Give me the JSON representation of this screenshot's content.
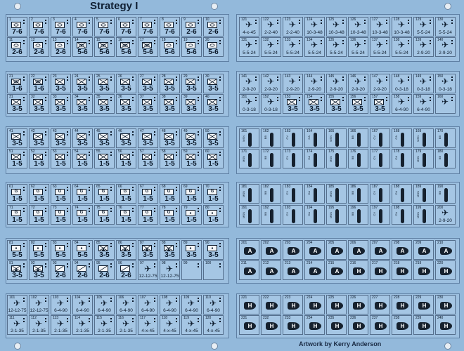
{
  "sheet": {
    "title": "Strategy I",
    "credit": "Artwork by Kerry Anderson",
    "colors": {
      "background": "#93b9db",
      "counter": "#a5c6e4",
      "ink": "#0c1a2b"
    }
  },
  "left_rows": [
    {
      "nums": [
        "1",
        "2",
        "3",
        "4",
        "5",
        "6",
        "7",
        "8",
        "9",
        "10"
      ],
      "stats": [
        "7-6",
        "7-6",
        "7-6",
        "7-6",
        "7-6",
        "7-6",
        "7-6",
        "7-6",
        "2-6",
        "2-6"
      ],
      "icons": [
        "armor",
        "armor",
        "armor",
        "armor",
        "armor",
        "armor",
        "armor",
        "armor",
        "armor",
        "armor"
      ]
    },
    {
      "nums": [
        "11",
        "12",
        "13",
        "14",
        "15",
        "16",
        "17",
        "18",
        "19",
        "20"
      ],
      "stats": [
        "2-6",
        "2-6",
        "2-6",
        "5-6",
        "5-6",
        "5-6",
        "5-6",
        "5-6",
        "5-6",
        "5-6"
      ],
      "icons": [
        "armor",
        "armor",
        "armor",
        "infantry-armor",
        "infantry-armor",
        "infantry-armor",
        "infantry-armor",
        "armor",
        "armor",
        "armor"
      ]
    },
    {
      "nums": [
        "21",
        "22",
        "23",
        "24",
        "25",
        "26",
        "27",
        "28",
        "29",
        "30"
      ],
      "stats": [
        "1-6",
        "1-6",
        "3-5",
        "3-5",
        "3-5",
        "3-5",
        "3-5",
        "3-5",
        "3-5",
        "3-5"
      ],
      "icons": [
        "infantry-armor",
        "infantry-armor",
        "infantry",
        "infantry",
        "infantry",
        "infantry",
        "infantry",
        "infantry",
        "infantry",
        "infantry"
      ]
    },
    {
      "nums": [
        "31",
        "32",
        "33",
        "34",
        "35",
        "36",
        "37",
        "38",
        "39",
        "40"
      ],
      "stats": [
        "3-5",
        "3-5",
        "3-5",
        "3-5",
        "3-5",
        "3-5",
        "3-5",
        "3-5",
        "3-5",
        "3-5"
      ],
      "icons": [
        "infantry",
        "infantry",
        "infantry",
        "infantry",
        "infantry",
        "infantry",
        "infantry",
        "infantry",
        "infantry",
        "infantry"
      ]
    },
    {
      "nums": [
        "41",
        "42",
        "43",
        "44",
        "45",
        "46",
        "47",
        "48",
        "49",
        "50"
      ],
      "stats": [
        "3-5",
        "3-5",
        "3-5",
        "3-5",
        "3-5",
        "3-5",
        "3-5",
        "3-5",
        "3-5",
        "3-5"
      ],
      "icons": [
        "infantry",
        "infantry",
        "infantry",
        "infantry",
        "infantry",
        "infantry",
        "infantry",
        "infantry",
        "infantry",
        "infantry"
      ]
    },
    {
      "nums": [
        "51",
        "52",
        "53",
        "54",
        "55",
        "56",
        "57",
        "58",
        "59",
        "60"
      ],
      "stats": [
        "1-5",
        "1-5",
        "1-5",
        "1-5",
        "1-5",
        "1-5",
        "1-5",
        "1-5",
        "1-5",
        "1-5"
      ],
      "icons": [
        "infantry",
        "infantry",
        "infantry",
        "infantry",
        "infantry",
        "infantry",
        "infantry",
        "infantry",
        "infantry",
        "infantry"
      ]
    },
    {
      "nums": [
        "61",
        "62",
        "63",
        "64",
        "65",
        "66",
        "67",
        "68",
        "69",
        "70"
      ],
      "stats": [
        "1-5",
        "1-5",
        "1-5",
        "1-5",
        "1-5",
        "1-5",
        "1-5",
        "1-5",
        "1-5",
        "1-5"
      ],
      "icons": [
        "guard",
        "guard",
        "guard",
        "guard",
        "guard",
        "guard",
        "guard",
        "guard",
        "guard",
        "guard"
      ]
    },
    {
      "nums": [
        "71",
        "72",
        "73",
        "74",
        "75",
        "76",
        "77",
        "78",
        "79",
        "80"
      ],
      "stats": [
        "1-5",
        "1-5",
        "1-5",
        "1-5",
        "1-5",
        "1-5",
        "1-5",
        "1-5",
        "1-5",
        "1-5"
      ],
      "icons": [
        "guard",
        "guard",
        "guard",
        "guard",
        "guard",
        "guard",
        "guard",
        "guard",
        "hq",
        "hq"
      ]
    },
    {
      "nums": [
        "81",
        "82",
        "83",
        "84",
        "85",
        "86",
        "87",
        "88",
        "89",
        "90"
      ],
      "stats": [
        "5-5",
        "5-5",
        "5-5",
        "5-5",
        "3-5",
        "3-5",
        "3-5",
        "3-5",
        "3-5",
        "3-5"
      ],
      "icons": [
        "hq",
        "hq",
        "hq",
        "hq",
        "mountain",
        "mountain",
        "mountain",
        "mountain",
        "hq",
        "hq"
      ]
    },
    {
      "nums": [
        "91",
        "92",
        "93",
        "94",
        "95",
        "96",
        "97",
        "98",
        "99",
        "100"
      ],
      "stats": [
        "3-5",
        "3-5",
        "2-6",
        "2-6",
        "2-6",
        "2-6",
        "12-12-75",
        "12-12-75",
        "",
        ""
      ],
      "icons": [
        "mountain",
        "mountain",
        "slash",
        "slash",
        "slash",
        "slash",
        "plane",
        "plane",
        "",
        ""
      ]
    },
    {
      "nums": [
        "101",
        "102",
        "103",
        "104",
        "105",
        "106",
        "107",
        "108",
        "109",
        "110"
      ],
      "stats": [
        "12-12-75",
        "12-12-75",
        "6-4-90",
        "6-4-90",
        "6-4-90",
        "6-4-90",
        "6-4-90",
        "6-4-90",
        "6-4-90",
        "6-4-90"
      ],
      "icons": [
        "plane",
        "plane",
        "plane",
        "plane",
        "plane",
        "plane",
        "plane",
        "plane",
        "plane",
        "plane"
      ]
    },
    {
      "nums": [
        "111",
        "112",
        "113",
        "114",
        "115",
        "116",
        "117",
        "118",
        "119",
        "120"
      ],
      "stats": [
        "2-1-35",
        "2-1-35",
        "2-1-35",
        "2-1-35",
        "2-1-35",
        "2-1-35",
        "4-x-45",
        "4-x-45",
        "4-x-45",
        "4-x-45"
      ],
      "icons": [
        "plane",
        "plane",
        "plane",
        "plane",
        "plane",
        "plane",
        "plane",
        "plane",
        "plane",
        "plane"
      ]
    }
  ],
  "right_rows": [
    {
      "nums": [
        "121",
        "122",
        "123",
        "124",
        "125",
        "126",
        "127",
        "128",
        "129",
        "130"
      ],
      "stats": [
        "4-x-45",
        "2-2-40",
        "2-2-40",
        "10-3-48",
        "10-3-48",
        "10-3-48",
        "10-3-48",
        "10-3-48",
        "5-5-24",
        "5-5-24"
      ],
      "kind": "air"
    },
    {
      "nums": [
        "131",
        "132",
        "133",
        "134",
        "135",
        "136",
        "137",
        "138",
        "139",
        "140"
      ],
      "stats": [
        "5-5-24",
        "5-5-24",
        "5-5-24",
        "5-5-24",
        "5-5-24",
        "5-5-24",
        "5-5-24",
        "5-5-24",
        "2-9-20",
        "2-9-20"
      ],
      "kind": "air"
    },
    {
      "nums": [
        "141",
        "142",
        "143",
        "144",
        "145",
        "146",
        "147",
        "148",
        "149",
        "150"
      ],
      "stats": [
        "2-9-20",
        "2-9-20",
        "2-9-20",
        "2-9-20",
        "2-9-20",
        "2-9-20",
        "2-9-20",
        "0-3-18",
        "0-3-18",
        "0-3-18"
      ],
      "kind": "air"
    },
    {
      "nums": [
        "151",
        "152",
        "153",
        "154",
        "155",
        "156",
        "157",
        "158",
        "159",
        "160"
      ],
      "stats": [
        "0-3-18",
        "0-3-18",
        "3-5",
        "3-5",
        "3-5",
        "3-5",
        "3-5",
        "6-4-90",
        "6-4-90",
        ""
      ],
      "kind": "mixed"
    },
    {
      "nums": [
        "161",
        "162",
        "163",
        "164",
        "165",
        "166",
        "167",
        "168",
        "169",
        "170"
      ],
      "stats": [],
      "kind": "ship"
    },
    {
      "nums": [
        "171",
        "172",
        "173",
        "174",
        "175",
        "176",
        "177",
        "178",
        "179",
        "180"
      ],
      "stats": [],
      "kind": "ship"
    },
    {
      "nums": [
        "181",
        "182",
        "183",
        "184",
        "185",
        "186",
        "187",
        "188",
        "189",
        "190"
      ],
      "stats": [],
      "kind": "ship"
    },
    {
      "nums": [
        "191",
        "192",
        "193",
        "194",
        "195",
        "196",
        "197",
        "198",
        "199",
        "200"
      ],
      "stats": [
        "",
        "",
        "",
        "",
        "",
        "",
        "",
        "",
        "",
        "2-9-20"
      ],
      "kind": "ship"
    },
    {
      "nums": [
        "201",
        "202",
        "203",
        "204",
        "205",
        "206",
        "207",
        "208",
        "209",
        "210"
      ],
      "letter": "A",
      "kind": "bomb"
    },
    {
      "nums": [
        "211",
        "212",
        "213",
        "214",
        "215",
        "216",
        "217",
        "218",
        "219",
        "220"
      ],
      "letter": "H",
      "kind": "bomb",
      "letters": [
        "A",
        "A",
        "A",
        "A",
        "A",
        "H",
        "H",
        "H",
        "H",
        "H"
      ]
    },
    {
      "nums": [
        "221",
        "222",
        "223",
        "224",
        "225",
        "226",
        "227",
        "228",
        "229",
        "230"
      ],
      "letter": "H",
      "kind": "bomb"
    },
    {
      "nums": [
        "231",
        "232",
        "233",
        "234",
        "235",
        "236",
        "237",
        "238",
        "239",
        "240"
      ],
      "letter": "H",
      "kind": "bomb"
    }
  ],
  "ship_labels": [
    "MSN",
    "BB",
    "CV",
    "CA"
  ]
}
